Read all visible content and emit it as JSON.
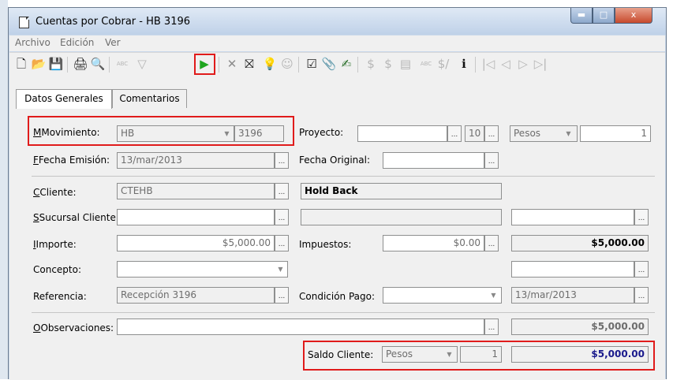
{
  "window": {
    "title": "Cuentas por Cobrar - HB 3196",
    "min": "▬",
    "max": "□",
    "close": "x"
  },
  "menu": [
    "Archivo",
    "Edición",
    "Ver"
  ],
  "toolbar": {
    "icons": {
      "new": "🗋",
      "open": "📂",
      "save": "💾",
      "print": "🖨",
      "preview": "🔍",
      "spell": "ABC",
      "filter": "▽",
      "run": "▶",
      "cancel": "✕",
      "delete": "⛝",
      "idea": "💡",
      "user": "☺",
      "check": "☑",
      "attach": "📎",
      "wizard": "✍",
      "money1": "$",
      "money2": "$",
      "calc": "▤",
      "abc2": "ABC",
      "sum": "$/",
      "info": "ℹ",
      "first": "|◁",
      "prev": "◁",
      "next": "▷",
      "last": "▷|"
    }
  },
  "tabs": {
    "general": "Datos Generales",
    "comments": "Comentarios"
  },
  "labels": {
    "movimiento": "Movimiento:",
    "fecha_emision": "Fecha Emisión:",
    "cliente": "Cliente:",
    "sucursal_cliente": "Sucursal Cliente:",
    "importe": "Importe:",
    "concepto": "Concepto:",
    "referencia": "Referencia:",
    "observaciones": "Observaciones:",
    "proyecto": "Proyecto:",
    "fecha_original": "Fecha Original:",
    "impuestos": "Impuestos:",
    "condicion_pago": "Condición Pago:",
    "saldo_cliente": "Saldo Cliente:"
  },
  "values": {
    "movimiento": "HB",
    "movimiento_num": "3196",
    "fecha_emision": "13/mar/2013",
    "cliente": "CTEHB",
    "cliente_nombre": "Hold Back",
    "importe": "$5,000.00",
    "impuestos": "$0.00",
    "importe_total": "$5,000.00",
    "referencia": "Recepción 3196",
    "fecha_vencimiento": "13/mar/2013",
    "proyecto_num": "10",
    "moneda": "Pesos",
    "tipo_cambio": "1",
    "observaciones_total": "$5,000.00",
    "saldo_moneda": "Pesos",
    "saldo_tc": "1",
    "saldo_total": "$5,000.00",
    "lookup": "...",
    "dropdown": "▼"
  },
  "colors": {
    "highlight": "#e01b1b",
    "run": "#1fa51f",
    "title_bar": "#c9d8ea",
    "saldo_text": "#1a1a8c"
  }
}
